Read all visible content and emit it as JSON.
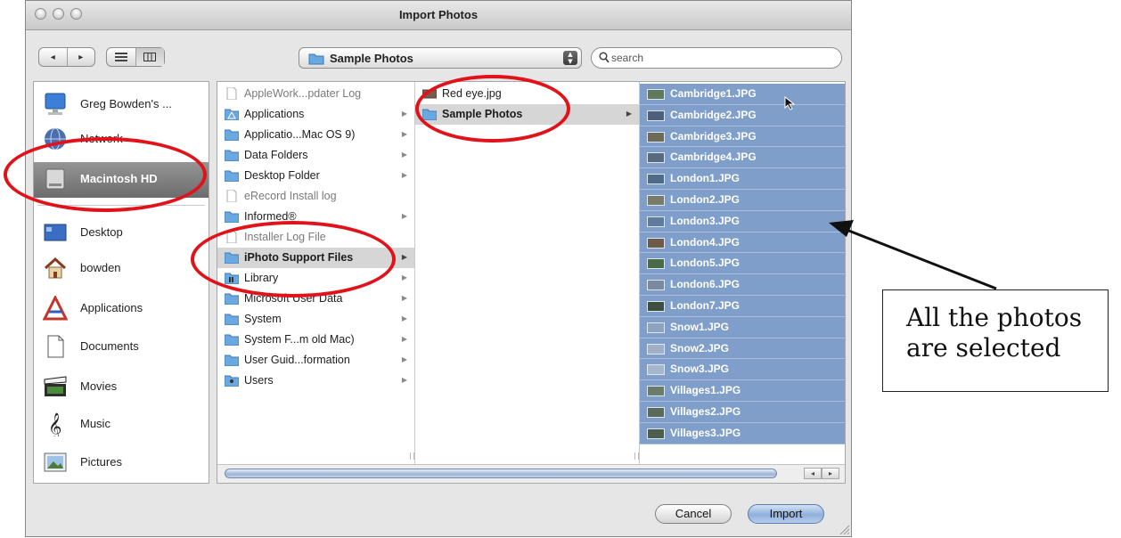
{
  "window": {
    "title": "Import Photos"
  },
  "toolbar": {
    "back_label": "◂",
    "forward_label": "▸",
    "view_list_icon": "list-view-icon",
    "view_column_icon": "column-view-icon",
    "location_popup": "Sample Photos",
    "search_placeholder": "search"
  },
  "sidebar": {
    "items": [
      {
        "label": "Greg Bowden's ...",
        "icon": "computer-icon"
      },
      {
        "label": "Network",
        "icon": "network-globe-icon"
      },
      {
        "label": "Macintosh HD",
        "icon": "hard-drive-icon",
        "selected": true
      },
      {
        "label": "Desktop",
        "icon": "desktop-icon"
      },
      {
        "label": "bowden",
        "icon": "home-icon"
      },
      {
        "label": "Applications",
        "icon": "applications-icon"
      },
      {
        "label": "Documents",
        "icon": "documents-icon"
      },
      {
        "label": "Movies",
        "icon": "movies-icon"
      },
      {
        "label": "Music",
        "icon": "music-icon"
      },
      {
        "label": "Pictures",
        "icon": "pictures-icon"
      }
    ]
  },
  "columns": {
    "col1": [
      {
        "label": "AppleWork...pdater Log",
        "type": "file",
        "dim": true
      },
      {
        "label": "Applications",
        "type": "folder"
      },
      {
        "label": "Applicatio...Mac OS 9)",
        "type": "folder"
      },
      {
        "label": "Data Folders",
        "type": "folder"
      },
      {
        "label": "Desktop Folder",
        "type": "folder"
      },
      {
        "label": "eRecord Install log",
        "type": "file",
        "dim": true
      },
      {
        "label": "Informed®",
        "type": "folder"
      },
      {
        "label": "Installer Log File",
        "type": "file",
        "dim": true
      },
      {
        "label": "iPhoto Support Files",
        "type": "folder",
        "selected": true
      },
      {
        "label": "Library",
        "type": "folder"
      },
      {
        "label": "Microsoft User Data",
        "type": "folder"
      },
      {
        "label": "System",
        "type": "folder"
      },
      {
        "label": "System F...m old Mac)",
        "type": "folder"
      },
      {
        "label": "User Guid...formation",
        "type": "folder"
      },
      {
        "label": "Users",
        "type": "folder"
      }
    ],
    "col2": [
      {
        "label": "Red eye.jpg",
        "type": "image"
      },
      {
        "label": "Sample Photos",
        "type": "folder",
        "selected": true
      }
    ],
    "col3": [
      "Cambridge1.JPG",
      "Cambridge2.JPG",
      "Cambridge3.JPG",
      "Cambridge4.JPG",
      "London1.JPG",
      "London2.JPG",
      "London3.JPG",
      "London4.JPG",
      "London5.JPG",
      "London6.JPG",
      "London7.JPG",
      "Snow1.JPG",
      "Snow2.JPG",
      "Snow3.JPG",
      "Villages1.JPG",
      "Villages2.JPG",
      "Villages3.JPG"
    ]
  },
  "buttons": {
    "cancel": "Cancel",
    "import": "Import"
  },
  "annotation": {
    "callout_line1": "All the photos",
    "callout_line2": "are selected"
  },
  "colors": {
    "selection_blue": "#7f9fca",
    "annotation_red": "#e2121a"
  }
}
